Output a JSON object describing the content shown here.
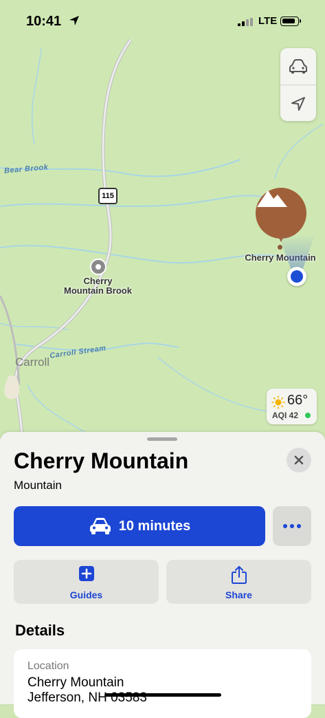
{
  "status_bar": {
    "time": "10:41",
    "network": "LTE"
  },
  "map_controls": {
    "transport_icon": "car-icon",
    "location_icon": "location-arrow-icon"
  },
  "map": {
    "labels": {
      "bear_brook": "Bear Brook",
      "route": "115",
      "poi": "Cherry\nMountain Brook",
      "pin": "Cherry Mountain",
      "carroll": "Carroll",
      "carroll_stream": "Carroll Stream"
    },
    "weather": {
      "temp": "66°",
      "aqi": "AQI 42"
    },
    "colors": {
      "land": "#cfe8b3",
      "water": "#a9d5e6",
      "road": "#c9c9c9",
      "pin": "#a0603a",
      "user": "#1c4fd6"
    }
  },
  "sheet": {
    "title": "Cherry Mountain",
    "subtitle": "Mountain",
    "directions_label": "10 minutes",
    "actions": [
      {
        "label": "Guides",
        "icon": "plus-square-icon"
      },
      {
        "label": "Share",
        "icon": "share-icon"
      }
    ],
    "details_heading": "Details",
    "location": {
      "key": "Location",
      "line1": "Cherry Mountain",
      "line2": "Jefferson, NH 03583"
    },
    "accent": "#1c46d4"
  }
}
